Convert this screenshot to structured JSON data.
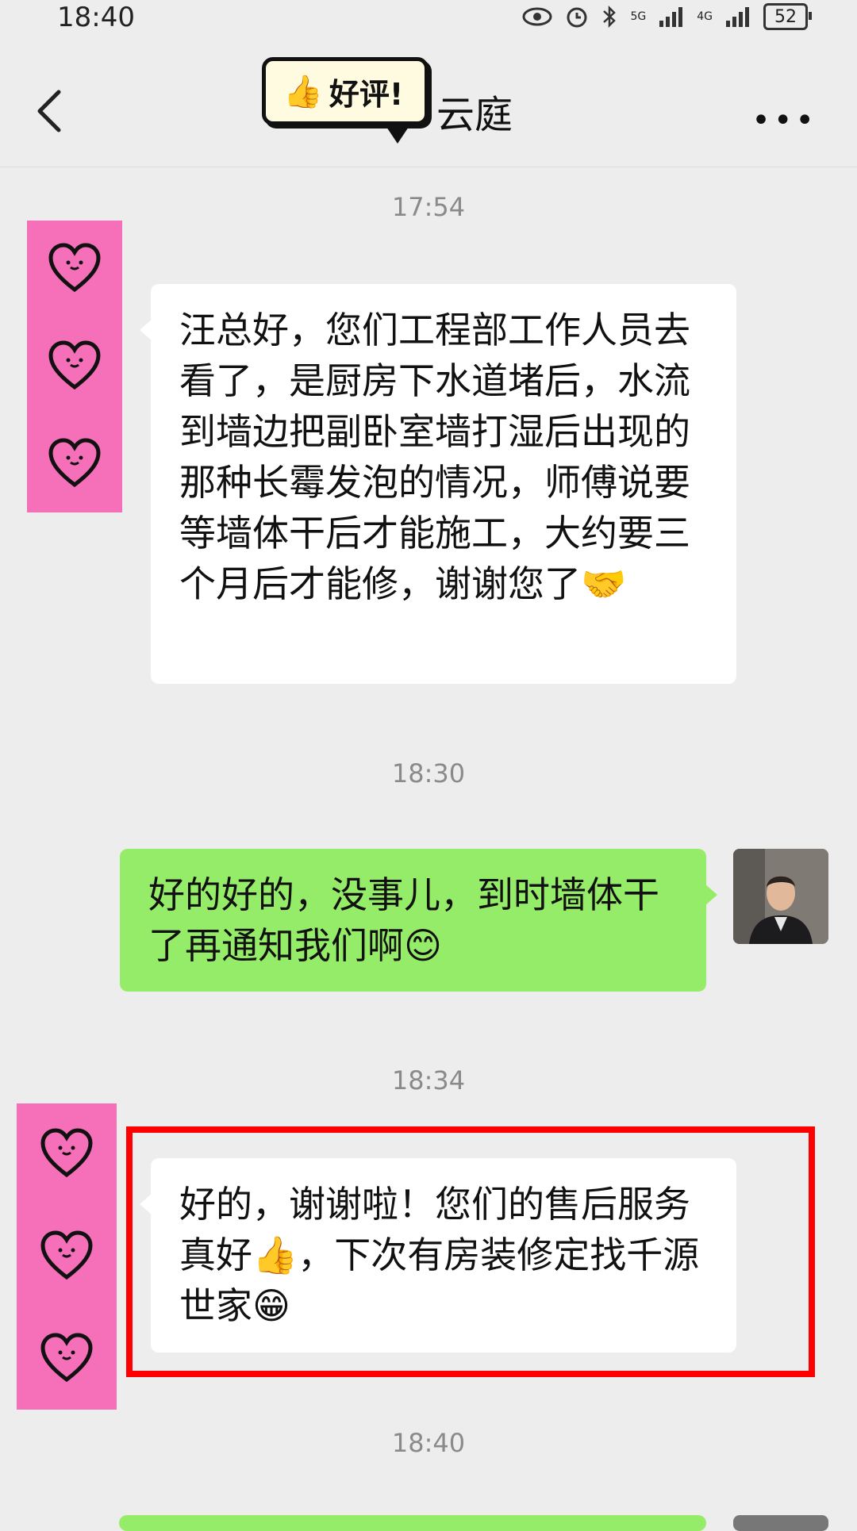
{
  "status_bar": {
    "time": "18:40",
    "signal1": "5G",
    "signal2": "4G",
    "battery": "52"
  },
  "header": {
    "title": "云庭",
    "badge": "好评!",
    "back_icon": "chevron-left-icon",
    "more_icon": "more-dots-icon"
  },
  "messages": [
    {
      "time": "17:54"
    },
    {
      "sender": "other",
      "text": "汪总好，您们工程部工作人员去看了，是厨房下水道堵后，水流到墙边把副卧室墙打湿后出现的那种长霉发泡的情况，师傅说要等墙体干后才能施工，大约要三个月后才能修，谢谢您了🤝"
    },
    {
      "time": "18:30"
    },
    {
      "sender": "self",
      "text": "好的好的，没事儿，到时墙体干了再通知我们啊😊"
    },
    {
      "time": "18:34"
    },
    {
      "sender": "other",
      "text": "好的，谢谢啦！您们的售后服务真好👍，下次有房装修定找千源世家😁",
      "highlighted": true
    },
    {
      "time": "18:40"
    }
  ],
  "colors": {
    "background": "#ededed",
    "self_bubble": "#95ec69",
    "other_bubble": "#ffffff",
    "pink_avatar": "#f56fb9",
    "highlight": "#ff0000"
  }
}
